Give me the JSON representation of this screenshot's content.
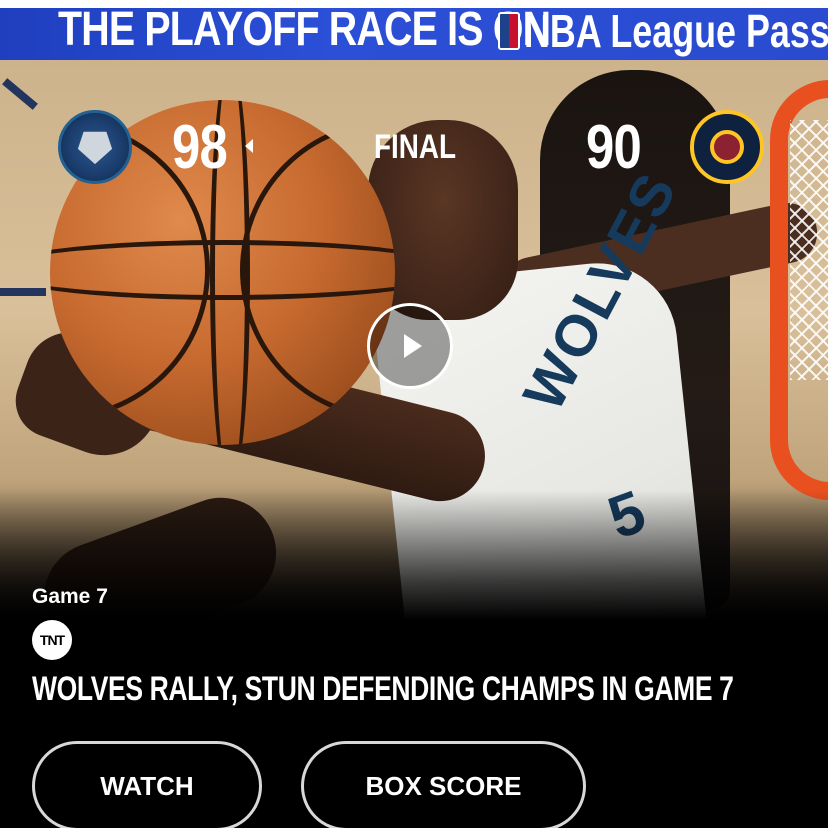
{
  "banner": {
    "headline": "THE PLAYOFF RACE IS ON",
    "brand": "NBA League Pass"
  },
  "game": {
    "home_team_logo": "minnesota-timberwolves-logo",
    "home_score": "98",
    "status": "FINAL",
    "away_score": "90",
    "away_team_logo": "denver-nuggets-logo",
    "winner_indicator": "left-arrow-icon"
  },
  "story": {
    "game_label": "Game 7",
    "network_logo_text": "TNT",
    "headline": "WOLVES RALLY, STUN DEFENDING CHAMPS IN GAME 7"
  },
  "photo_text": {
    "jersey_text": "WOLVES",
    "jersey_number": "5"
  },
  "actions": {
    "watch_label": "WATCH",
    "box_score_label": "BOX SCORE"
  },
  "icons": {
    "play": "play-icon"
  },
  "colors": {
    "banner_blue": "#2b4fd6",
    "background": "#000000",
    "text": "#ffffff",
    "button_border": "#d8d8d8"
  }
}
